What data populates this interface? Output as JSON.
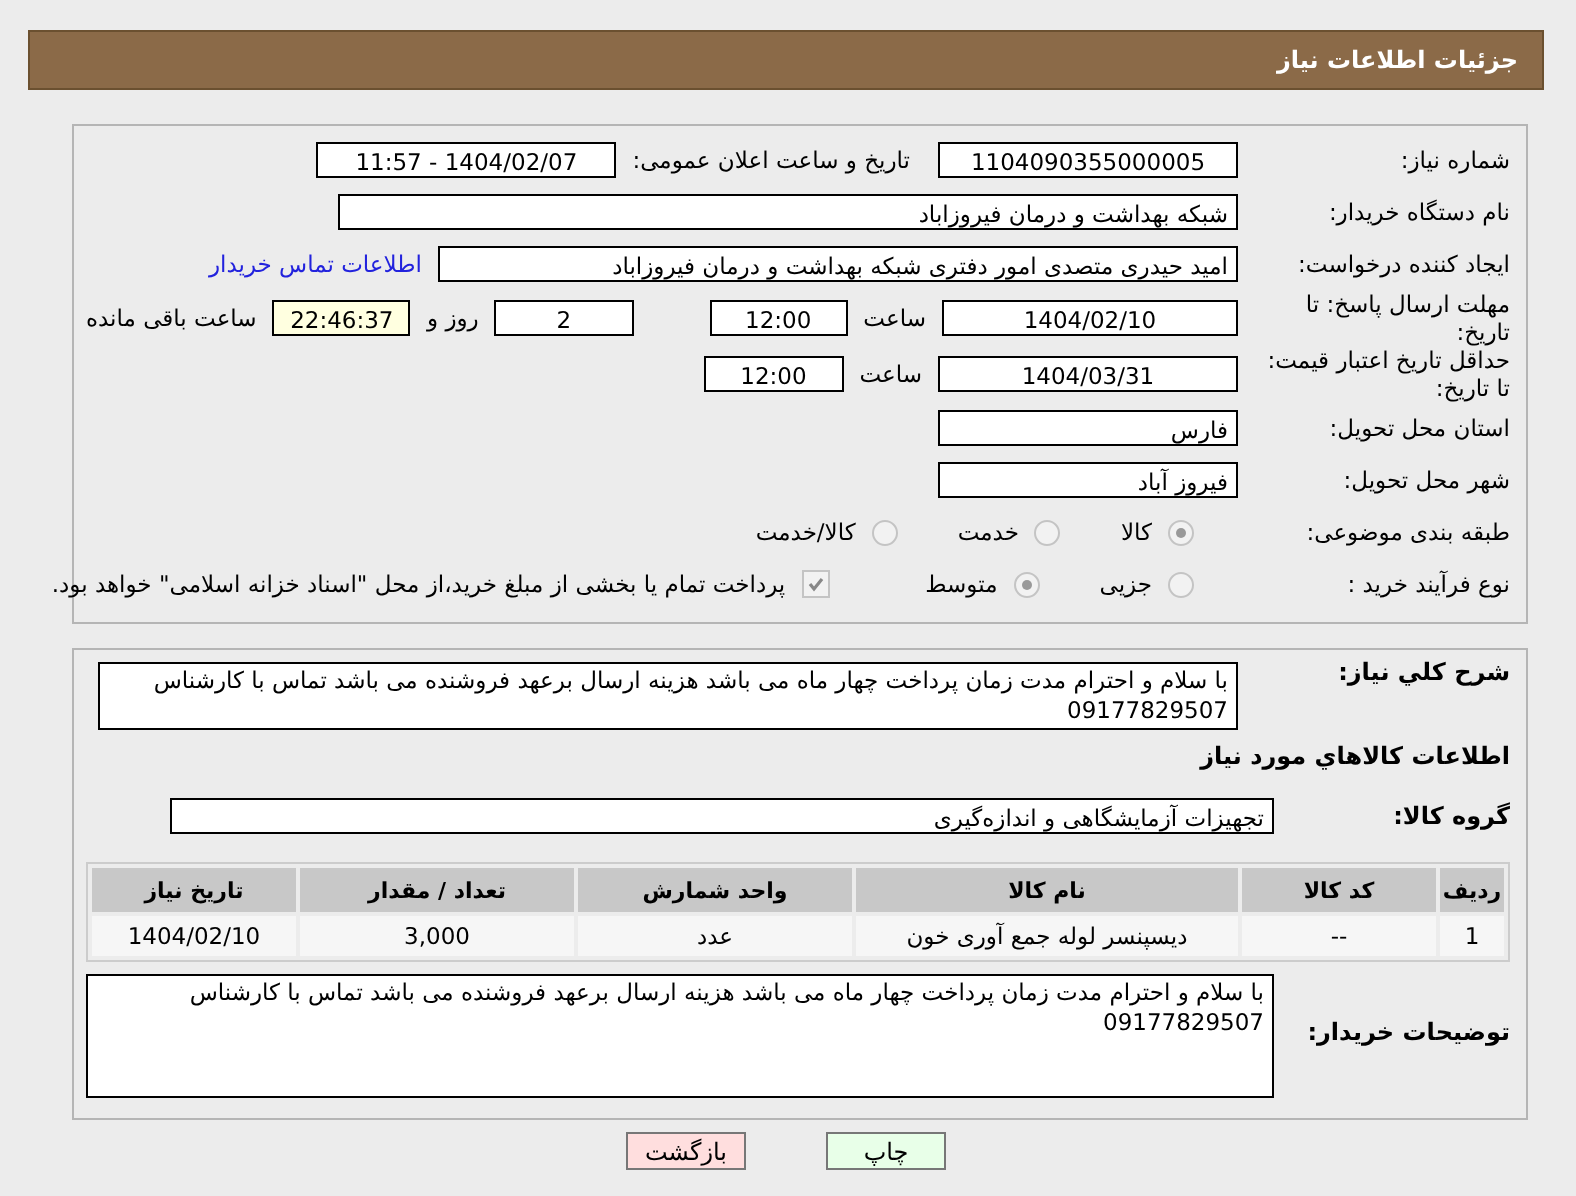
{
  "header": {
    "title": "جزئیات اطلاعات نیاز"
  },
  "need_number": {
    "label": "شماره نیاز:",
    "value": "1104090355000005"
  },
  "announce": {
    "label": "تاریخ و ساعت اعلان عمومی:",
    "value": "1404/02/07 - 11:57"
  },
  "buyer": {
    "label": "نام دستگاه خریدار:",
    "value": "شبکه بهداشت و درمان فیروزاباد"
  },
  "requester": {
    "label": "ایجاد کننده درخواست:",
    "value": "امید حیدری متصدی امور دفتری شبکه بهداشت و درمان فیروزاباد",
    "link": "اطلاعات تماس خریدار"
  },
  "deadline": {
    "label": "مهلت ارسال پاسخ: تا تاریخ:",
    "date": "1404/02/10",
    "time_label": "ساعت",
    "time": "12:00",
    "days": "2",
    "days_label": "روز و",
    "remaining": "22:46:37",
    "remaining_label": "ساعت باقی مانده"
  },
  "validity": {
    "label": "حداقل تاریخ اعتبار قیمت: تا تاریخ:",
    "date": "1404/03/31",
    "time_label": "ساعت",
    "time": "12:00"
  },
  "province": {
    "label": "استان محل تحویل:",
    "value": "فارس"
  },
  "city": {
    "label": "شهر محل تحویل:",
    "value": "فیروز آباد"
  },
  "category": {
    "label": "طبقه بندی موضوعی:",
    "options": [
      {
        "label": "کالا",
        "selected": true
      },
      {
        "label": "خدمت",
        "selected": false
      },
      {
        "label": "کالا/خدمت",
        "selected": false
      }
    ]
  },
  "process": {
    "label": "نوع فرآیند خرید :",
    "options": [
      {
        "label": "جزیی",
        "selected": false
      },
      {
        "label": "متوسط",
        "selected": true
      }
    ],
    "payment": {
      "label": "پرداخت تمام یا بخشی از مبلغ خرید،از محل \"اسناد خزانه اسلامی\" خواهد بود.",
      "checked": true
    }
  },
  "summary": {
    "label": "شرح کلي نياز:",
    "value": "با سلام و احترام مدت زمان پرداخت چهار ماه می باشد هزینه ارسال برعهد فروشنده می باشد تماس با کارشناس 09177829507"
  },
  "goods_title": "اطلاعات کالاهاي مورد نياز",
  "group": {
    "label": "گروه کالا:",
    "value": "تجهیزات آزمایشگاهی و اندازه‌گیری"
  },
  "table": {
    "columns": [
      "ردیف",
      "کد کالا",
      "نام کالا",
      "واحد شمارش",
      "تعداد / مقدار",
      "تاریخ نیاز"
    ],
    "rows": [
      [
        "1",
        "--",
        "دیسپنسر لوله جمع آوری خون",
        "عدد",
        "3,000",
        "1404/02/10"
      ]
    ]
  },
  "notes": {
    "label": "توضیحات خریدار:",
    "value": "با سلام و احترام مدت زمان پرداخت چهار ماه می باشد هزینه ارسال برعهد فروشنده می باشد تماس با کارشناس 09177829507"
  },
  "buttons": [
    {
      "label": "چاپ",
      "kind": "print"
    },
    {
      "label": "بازگشت",
      "kind": "back"
    }
  ]
}
